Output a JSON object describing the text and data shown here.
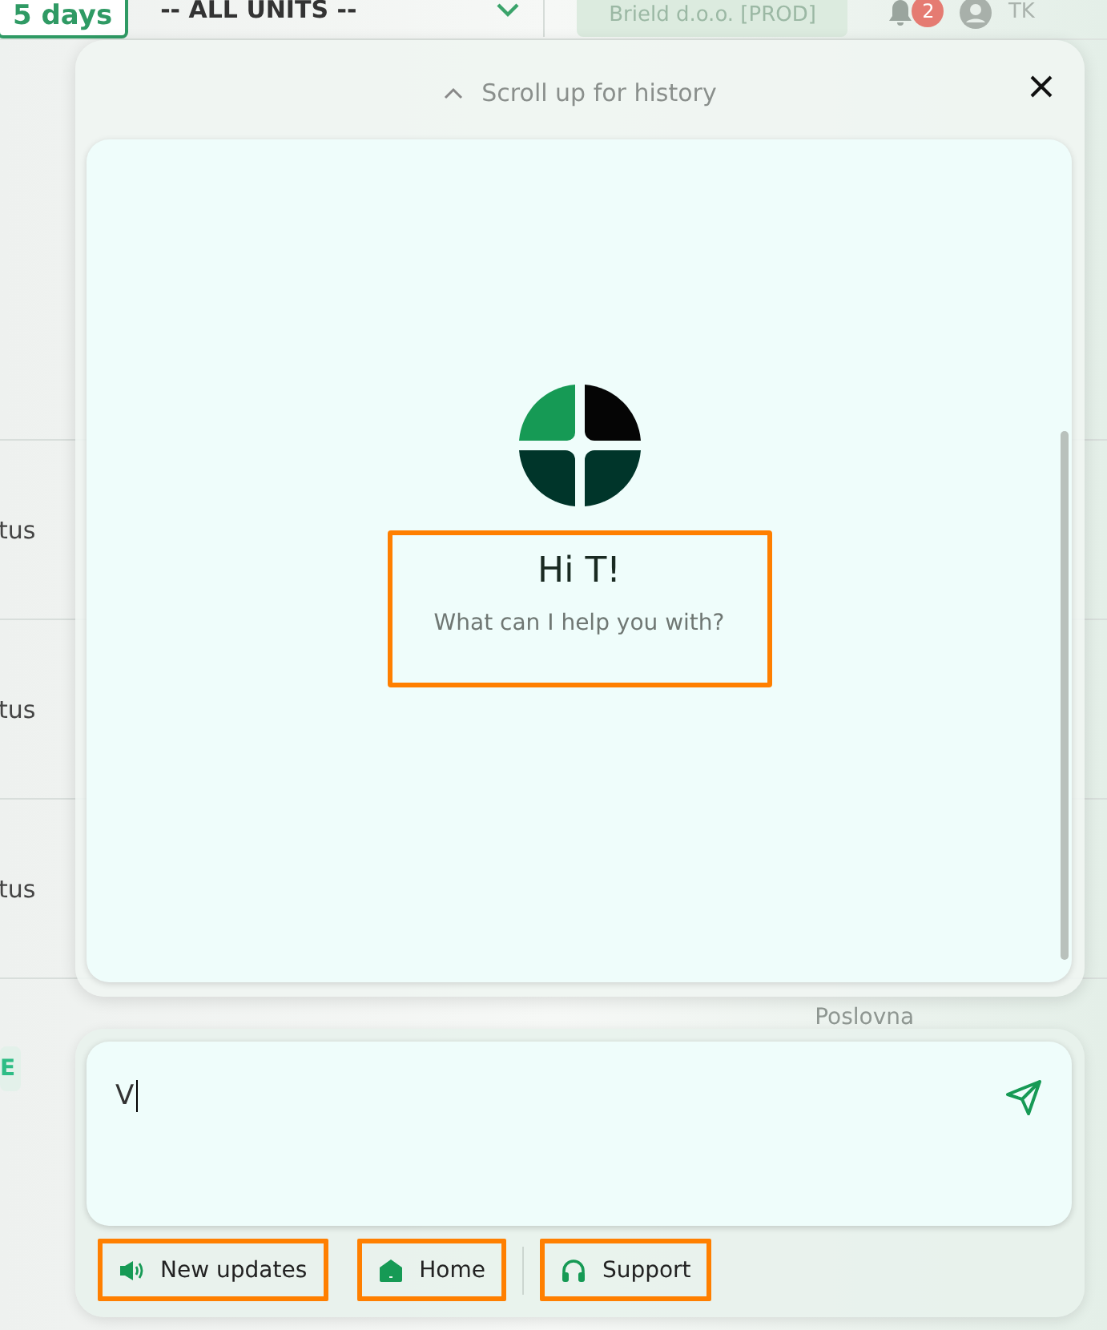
{
  "background_app": {
    "period_button": "5 days",
    "unit_select": "-- ALL UNITS --",
    "company": "Brield d.o.o. [PROD]",
    "notification_count": "2",
    "user_initials": "TK",
    "table": {
      "rows": [
        {
          "cell": "tus"
        },
        {
          "cell": "tus"
        },
        {
          "cell": "tus"
        },
        {
          "cell": "E",
          "kind": "badge",
          "cell_2": "Poslovna"
        }
      ]
    }
  },
  "chat": {
    "history_hint": "Scroll up for history",
    "greeting": "Hi T!",
    "subtitle": "What can I help you with?",
    "greeting_highlighted": true,
    "input": {
      "value": "V"
    },
    "actions": [
      {
        "label": "New updates",
        "highlighted": true
      },
      {
        "label": "Home",
        "highlighted": true
      },
      {
        "label": "Support",
        "highlighted": true
      }
    ]
  }
}
